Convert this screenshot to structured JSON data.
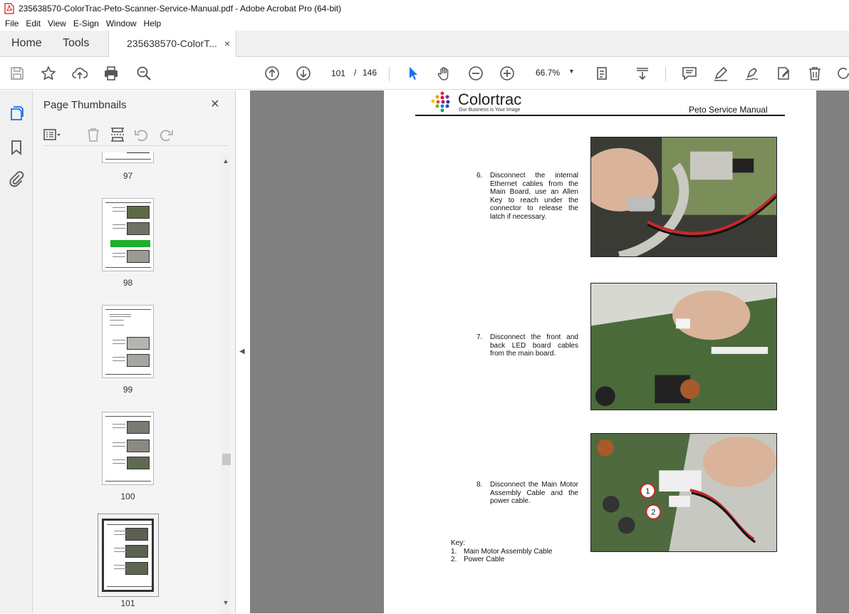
{
  "window": {
    "title": "235638570-ColorTrac-Peto-Scanner-Service-Manual.pdf - Adobe Acrobat Pro (64-bit)"
  },
  "menu": [
    "File",
    "Edit",
    "View",
    "E-Sign",
    "Window",
    "Help"
  ],
  "tabs": {
    "home": "Home",
    "tools": "Tools",
    "doc": "235638570-ColorT...",
    "close": "×"
  },
  "toolbar": {
    "page_current": "101",
    "page_sep": "/",
    "page_total": "146",
    "zoom": "66.7%",
    "zoom_caret": "▼"
  },
  "panel": {
    "title": "Page Thumbnails",
    "close": "×",
    "thumbnails": [
      {
        "label": "97"
      },
      {
        "label": "98"
      },
      {
        "label": "99"
      },
      {
        "label": "100"
      },
      {
        "label": "101",
        "selected": true
      }
    ]
  },
  "page": {
    "logo_name": "Colortrac",
    "logo_tagline": "Our Business is Your Image",
    "header_right": "Peto Service Manual",
    "steps": [
      {
        "num": "6.",
        "text": "Disconnect the internal Ethernet cables from the Main Board, use an Allen Key to reach under the connector to release the latch if necessary."
      },
      {
        "num": "7.",
        "text": "Disconnect the front and back LED board cables from the main board."
      },
      {
        "num": "8.",
        "text": "Disconnect the Main Motor Assembly Cable and the power cable."
      }
    ],
    "key": {
      "title": "Key:",
      "items": [
        {
          "num": "1.",
          "text": "Main Motor Assembly Cable"
        },
        {
          "num": "2.",
          "text": "Power Cable"
        }
      ]
    },
    "callouts": [
      "1",
      "2"
    ]
  },
  "colors": {
    "accent": "#1473e6",
    "docbg": "#808080",
    "pdf_red": "#d2161e"
  }
}
